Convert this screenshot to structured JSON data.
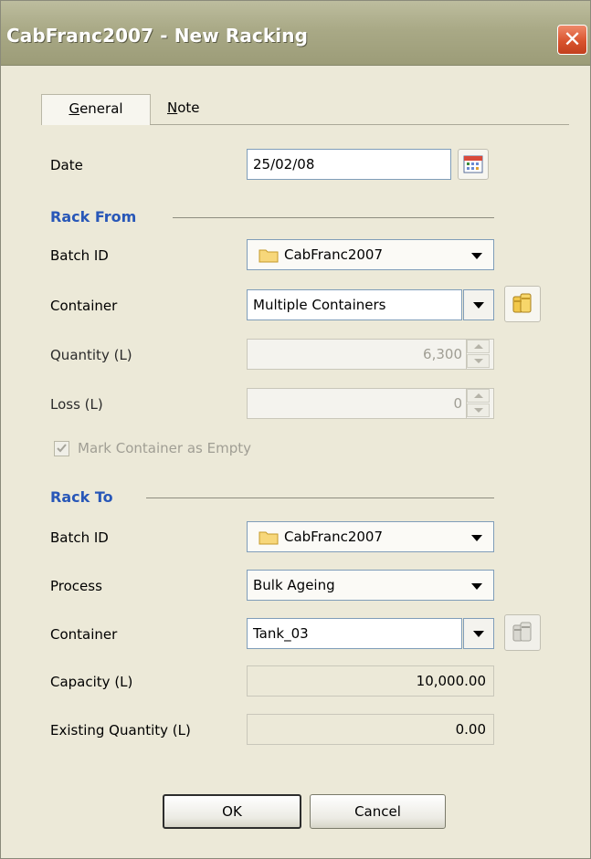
{
  "window": {
    "title": "CabFranc2007 - New Racking",
    "close_glyph": "✕"
  },
  "tabs": [
    {
      "label": "General",
      "mnemonic": "G",
      "rest": "eneral"
    },
    {
      "label": "Note",
      "mnemonic": "N",
      "rest": "ote"
    }
  ],
  "general": {
    "date_label": "Date",
    "date_value": "25/02/08"
  },
  "rack_from": {
    "section_title": "Rack From",
    "batch_label": "Batch ID",
    "batch_value": "CabFranc2007",
    "container_label": "Container",
    "container_value": "Multiple Containers",
    "quantity_label": "Quantity (L)",
    "quantity_value": "6,300",
    "loss_label": "Loss (L)",
    "loss_value": "0",
    "mark_empty_label": "Mark Container as Empty",
    "mark_empty_checked": true
  },
  "rack_to": {
    "section_title": "Rack To",
    "batch_label": "Batch ID",
    "batch_value": "CabFranc2007",
    "process_label": "Process",
    "process_value": "Bulk Ageing",
    "container_label": "Container",
    "container_value": "Tank_03",
    "capacity_label": "Capacity (L)",
    "capacity_value": "10,000.00",
    "existing_label": "Existing Quantity (L)",
    "existing_value": "0.00"
  },
  "buttons": {
    "ok": "OK",
    "cancel": "Cancel"
  },
  "icons": {
    "calendar": "calendar-icon",
    "folder": "folder-icon",
    "containers": "containers-icon",
    "check": "check-icon"
  },
  "colors": {
    "section": "#2857b8",
    "close": "#d9542f",
    "titlebar": "#a9a986"
  }
}
